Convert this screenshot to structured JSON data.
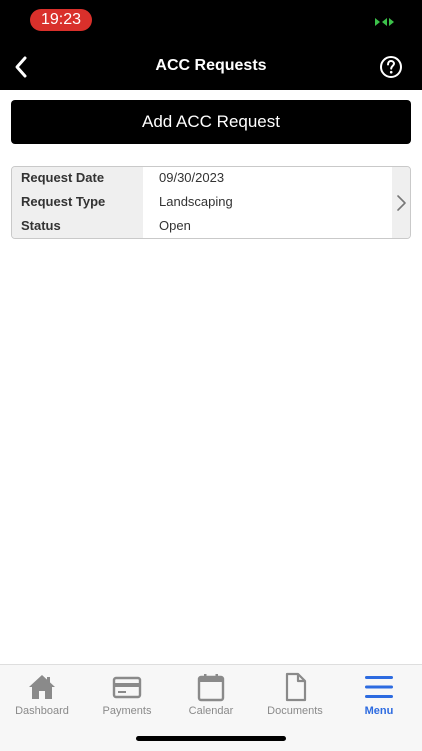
{
  "status_bar": {
    "time": "19:23",
    "time_pill_color": "#d9302b",
    "status_glyph_color": "#3cc24a"
  },
  "nav": {
    "title": "ACC Requests",
    "back_icon": "chevron-left-icon",
    "help_icon": "question-circle-icon"
  },
  "actions": {
    "add_label": "Add ACC Request"
  },
  "request": {
    "rows": [
      {
        "label": "Request Date",
        "value": "09/30/2023"
      },
      {
        "label": "Request Type",
        "value": "Landscaping"
      },
      {
        "label": "Status",
        "value": "Open"
      }
    ]
  },
  "tabs": [
    {
      "label": "Dashboard",
      "icon": "home-icon",
      "active": false
    },
    {
      "label": "Payments",
      "icon": "credit-card-icon",
      "active": false
    },
    {
      "label": "Calendar",
      "icon": "calendar-icon",
      "active": false
    },
    {
      "label": "Documents",
      "icon": "document-icon",
      "active": false
    },
    {
      "label": "Menu",
      "icon": "menu-icon",
      "active": true
    }
  ],
  "colors": {
    "header_bg": "#000000",
    "active_tab": "#2d6be0",
    "inactive_tab": "#8a8a8a"
  }
}
